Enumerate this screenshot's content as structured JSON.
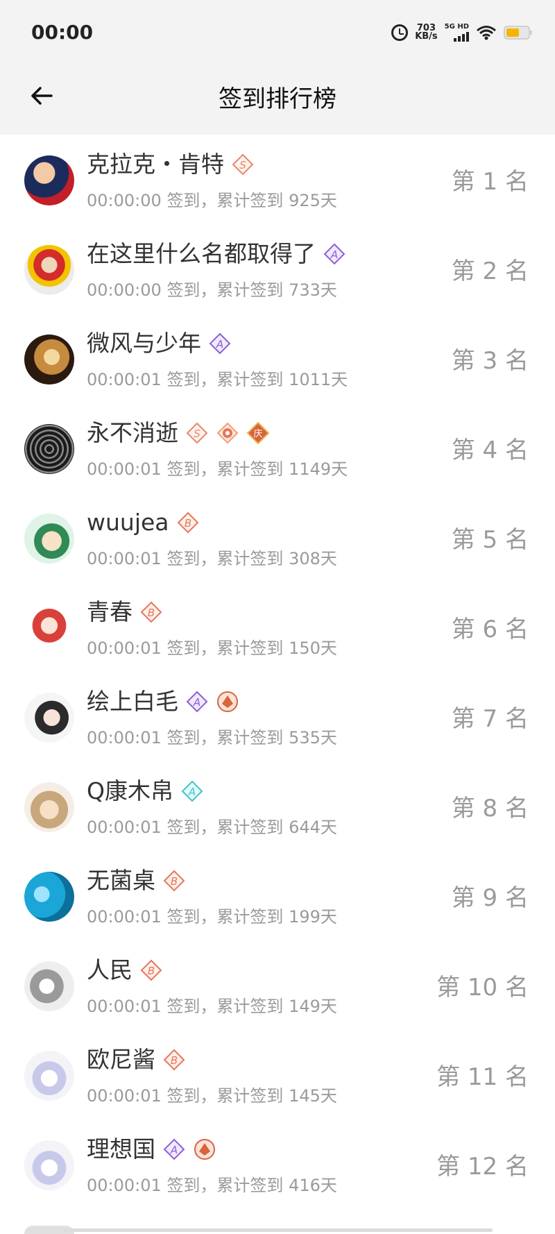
{
  "status": {
    "time": "00:00",
    "speed_value": "703",
    "speed_unit": "KB/s",
    "network": "5G HD"
  },
  "header": {
    "title": "签到排行榜"
  },
  "colors": {
    "badge_s": "#e8866b",
    "badge_a": "#8e5fd6",
    "badge_b": "#e5765a",
    "badge_a_teal": "#42c4c9",
    "badge_qing": "#d9643c"
  },
  "rows": [
    {
      "name": "克拉克・肯特",
      "time": "00:00:00",
      "signed": "签到，累计签到",
      "days": "925天",
      "rank": "第 1 名",
      "badges": [
        "badge-s-icon"
      ],
      "avatar_icon": "superhero-avatar-icon"
    },
    {
      "name": "在这里什么名都取得了",
      "time": "00:00:00",
      "signed": "签到，累计签到",
      "days": "733天",
      "rank": "第 2 名",
      "badges": [
        "badge-a-icon"
      ],
      "avatar_icon": "clown-avatar-icon"
    },
    {
      "name": "微风与少年",
      "time": "00:00:01",
      "signed": "签到，累计签到",
      "days": "1011天",
      "rank": "第 3 名",
      "badges": [
        "badge-a-icon"
      ],
      "avatar_icon": "fire-avatar-icon"
    },
    {
      "name": "永不消逝",
      "time": "00:00:01",
      "signed": "签到，累计签到",
      "days": "1149天",
      "rank": "第 4 名",
      "badges": [
        "badge-s-icon",
        "badge-flower-icon",
        "badge-qing-icon"
      ],
      "avatar_icon": "mech-avatar-icon"
    },
    {
      "name": "wuujea",
      "time": "00:00:01",
      "signed": "签到，累计签到",
      "days": "308天",
      "rank": "第 5 名",
      "badges": [
        "badge-b-icon"
      ],
      "avatar_icon": "anime-avatar-icon"
    },
    {
      "name": "青春",
      "time": "00:00:01",
      "signed": "签到，累计签到",
      "days": "150天",
      "rank": "第 6 名",
      "badges": [
        "badge-b-icon"
      ],
      "avatar_icon": "anime-avatar-icon"
    },
    {
      "name": "绘上白毛",
      "time": "00:00:01",
      "signed": "签到，累计签到",
      "days": "535天",
      "rank": "第 7 名",
      "badges": [
        "badge-a-icon",
        "badge-crest-icon"
      ],
      "avatar_icon": "anime-avatar-icon"
    },
    {
      "name": "Q康木帛",
      "time": "00:00:01",
      "signed": "签到，累计签到",
      "days": "644天",
      "rank": "第 8 名",
      "badges": [
        "badge-a-teal-icon"
      ],
      "avatar_icon": "anime-avatar-icon"
    },
    {
      "name": "无菌桌",
      "time": "00:00:01",
      "signed": "签到，累计签到",
      "days": "199天",
      "rank": "第 9 名",
      "badges": [
        "badge-b-icon"
      ],
      "avatar_icon": "water-avatar-icon"
    },
    {
      "name": "人民",
      "time": "00:00:01",
      "signed": "签到，累计签到",
      "days": "149天",
      "rank": "第 10 名",
      "badges": [
        "badge-b-icon"
      ],
      "avatar_icon": "anime-avatar-icon"
    },
    {
      "name": "欧尼酱",
      "time": "00:00:01",
      "signed": "签到，累计签到",
      "days": "145天",
      "rank": "第 11 名",
      "badges": [
        "badge-b-icon"
      ],
      "avatar_icon": "anime-avatar-icon"
    },
    {
      "name": "理想国",
      "time": "00:00:01",
      "signed": "签到，累计签到",
      "days": "416天",
      "rank": "第 12 名",
      "badges": [
        "badge-a-icon",
        "badge-crest-icon"
      ],
      "avatar_icon": "anime-avatar-icon"
    }
  ]
}
